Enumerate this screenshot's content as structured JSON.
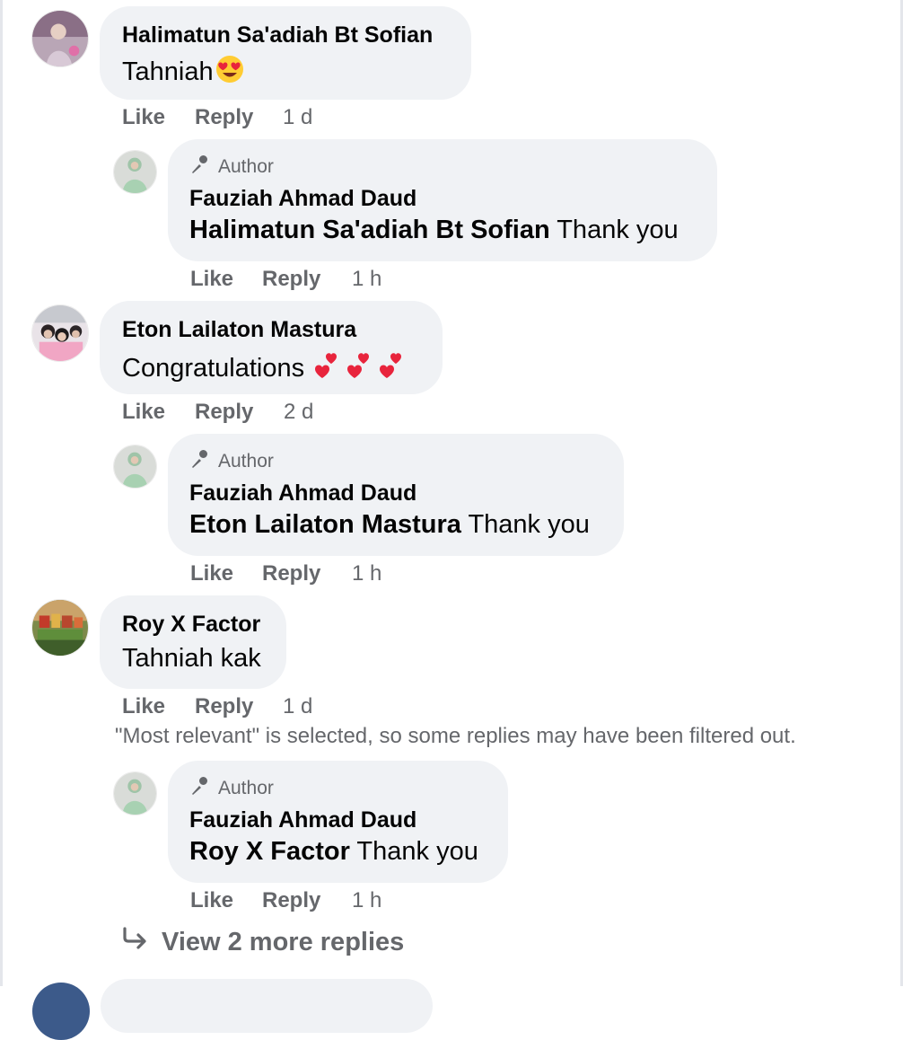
{
  "ui": {
    "like_label": "Like",
    "reply_label": "Reply",
    "author_badge": "Author",
    "filter_notice": "\"Most relevant\" is selected, so some replies may have been filtered out.",
    "view_more_replies": "View 2 more replies"
  },
  "comments": [
    {
      "name": "Halimatun Sa'adiah Bt Sofian",
      "text": "Tahniah",
      "emoji": "heart-eyes-emoji",
      "time": "1 d",
      "reply": {
        "name": "Fauziah Ahmad Daud",
        "mention": "Halimatun Sa'adiah Bt Sofian",
        "text": " Thank you",
        "time": "1 h"
      }
    },
    {
      "name": "Eton Lailaton Mastura",
      "text": "Congratulations ",
      "emoji": "two-hearts-emoji",
      "time": "2 d",
      "reply": {
        "name": "Fauziah Ahmad Daud",
        "mention": "Eton Lailaton Mastura",
        "text": " Thank you",
        "time": "1 h"
      }
    },
    {
      "name": "Roy X Factor",
      "text": "Tahniah kak",
      "time": "1 d",
      "reply": {
        "name": "Fauziah Ahmad Daud",
        "mention": "Roy X Factor",
        "text": " Thank you",
        "time": "1 h"
      }
    }
  ],
  "colors": {
    "bubble": "#f0f2f5",
    "secondary_text": "#65676b",
    "primary_text": "#050505"
  }
}
